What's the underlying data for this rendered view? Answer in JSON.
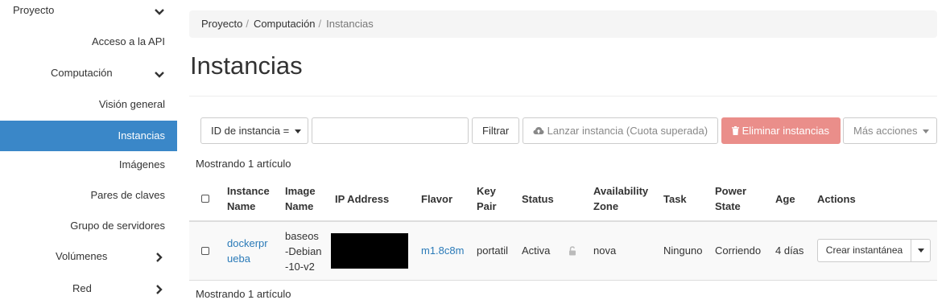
{
  "sidebar": {
    "project_label": "Proyecto",
    "items": {
      "api_access": "Acceso a la API",
      "compute": "Computación",
      "overview": "Visión general",
      "instances": "Instancias",
      "images": "Imágenes",
      "key_pairs": "Pares de claves",
      "server_groups": "Grupo de servidores",
      "volumes": "Volúmenes",
      "network": "Red"
    },
    "active_color": "#3a87c8"
  },
  "breadcrumb": {
    "items": [
      "Proyecto",
      "Computación"
    ],
    "current": "Instancias",
    "separator": "/"
  },
  "page_title": "Instancias",
  "toolbar": {
    "filter_select_label": "ID de instancia =",
    "filter_input_value": "",
    "filter_button": "Filtrar",
    "launch_button": "Lanzar instancia (Cuota superada)",
    "delete_button": "Eliminar instancias",
    "more_actions": "Más acciones",
    "danger_color": "#ea8e8a"
  },
  "count_top": "Mostrando 1 artículo",
  "count_bottom": "Mostrando 1 artículo",
  "table": {
    "headers": {
      "instance_name": [
        "Instance",
        "Name"
      ],
      "image_name": [
        "Image",
        "Name"
      ],
      "ip_address": "IP Address",
      "flavor": "Flavor",
      "key_pair": [
        "Key",
        "Pair"
      ],
      "status": "Status",
      "availability_zone": [
        "Availability",
        "Zone"
      ],
      "task": "Task",
      "power_state": [
        "Power",
        "State"
      ],
      "age": "Age",
      "actions": "Actions"
    },
    "rows": [
      {
        "instance_name": [
          "dockerpr",
          "ueba"
        ],
        "image_name": [
          "baseos",
          "-Debian",
          "-10-v2"
        ],
        "ip_address": "",
        "flavor": "m1.8c8m",
        "key_pair": "portatil",
        "status": "Activa",
        "availability_zone": "nova",
        "task": "Ninguno",
        "power_state": "Corriendo",
        "age": "4 días",
        "action_button": "Crear instantánea"
      }
    ]
  },
  "icons": {
    "chevron_down": "chevron-down-icon",
    "chevron_right": "chevron-right-icon",
    "cloud_upload": "cloud-upload-icon",
    "trash": "trash-icon",
    "lock": "lock-icon"
  },
  "link_color": "#2a7ab8"
}
